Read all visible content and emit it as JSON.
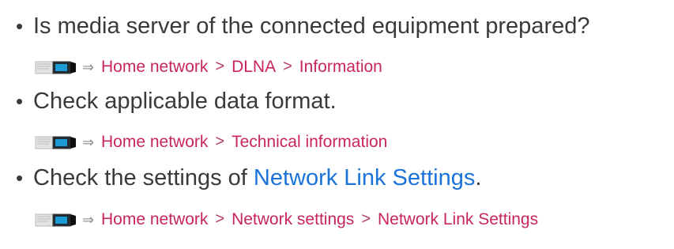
{
  "items": [
    {
      "bullet": "•",
      "text": "Is media server of the connected equipment prepared?",
      "breadcrumb": [
        "Home network",
        "DLNA",
        "Information"
      ]
    },
    {
      "bullet": "•",
      "text": "Check applicable data format.",
      "breadcrumb": [
        "Home network",
        "Technical information"
      ]
    },
    {
      "bullet": "•",
      "text_before": "Check the settings of ",
      "link": "Network Link Settings",
      "text_after": ".",
      "breadcrumb": [
        "Home network",
        "Network settings",
        "Network Link Settings"
      ]
    }
  ],
  "symbols": {
    "arrow": "⇒",
    "separator": ">"
  },
  "colors": {
    "body_text": "#3a3a3a",
    "breadcrumb": "#c8265b",
    "link": "#1a73d9",
    "icon_dark": "#1a1a1a",
    "icon_teal": "#1a9bd4",
    "icon_light": "#d7d7d7"
  },
  "icons": {
    "book": "guide-book-icon",
    "arrow": "right-arrow-icon"
  }
}
